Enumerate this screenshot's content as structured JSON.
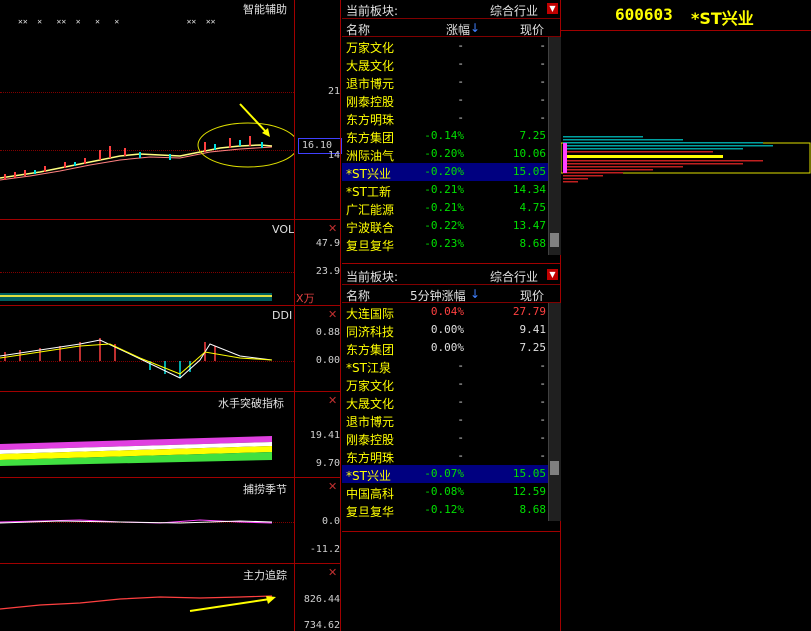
{
  "chart_area": {
    "main_panel": {
      "title": "智能辅助",
      "y_labels": [
        "21",
        "16.10",
        "14"
      ],
      "top_markers": "✕✕  ✕   ✕✕  ✕   ✕   ✕              ✕✕  ✕✕"
    },
    "vol_panel": {
      "title": "VOL",
      "y_labels": [
        "47.9",
        "23.9"
      ],
      "unit": "X万"
    },
    "ddi_panel": {
      "title": "DDI",
      "y_labels": [
        "0.88",
        "0.00"
      ]
    },
    "sailor_panel": {
      "title": "水手突破指标",
      "y_labels": [
        "19.41",
        "9.70"
      ]
    },
    "season_panel": {
      "title": "捕捞季节",
      "y_labels": [
        "0.0",
        "-11.2"
      ]
    },
    "main_force_panel": {
      "title": "主力追踪",
      "y_labels": [
        "826.44",
        "734.62"
      ]
    },
    "close_label": "✕"
  },
  "sector_list_1": {
    "label": "当前板块:",
    "dropdown": "综合行业",
    "headers": {
      "name": "名称",
      "change": "涨幅",
      "price": "现价"
    },
    "rows": [
      {
        "name": "万家文化",
        "change": "-",
        "price": "-"
      },
      {
        "name": "大晟文化",
        "change": "-",
        "price": "-"
      },
      {
        "name": "退市博元",
        "change": "-",
        "price": "-"
      },
      {
        "name": "刚泰控股",
        "change": "-",
        "price": "-"
      },
      {
        "name": "东方明珠",
        "change": "-",
        "price": "-"
      },
      {
        "name": "东方集团",
        "change": "-0.14%",
        "price": "7.25"
      },
      {
        "name": "洲际油气",
        "change": "-0.20%",
        "price": "10.06"
      },
      {
        "name": "*ST兴业",
        "change": "-0.20%",
        "price": "15.05"
      },
      {
        "name": "*ST工新",
        "change": "-0.21%",
        "price": "14.34"
      },
      {
        "name": "广汇能源",
        "change": "-0.21%",
        "price": "4.75"
      },
      {
        "name": "宁波联合",
        "change": "-0.22%",
        "price": "13.47"
      },
      {
        "name": "复旦复华",
        "change": "-0.23%",
        "price": "8.68"
      }
    ]
  },
  "sector_list_2": {
    "label": "当前板块:",
    "dropdown": "综合行业",
    "headers": {
      "name": "名称",
      "change": "5分钟涨幅",
      "price": "现价"
    },
    "rows": [
      {
        "name": "大连国际",
        "change": "0.04%",
        "price": "27.79"
      },
      {
        "name": "同济科技",
        "change": "0.00%",
        "price": "9.41"
      },
      {
        "name": "东方集团",
        "change": "0.00%",
        "price": "7.25"
      },
      {
        "name": "*ST江泉",
        "change": "-",
        "price": "-"
      },
      {
        "name": "万家文化",
        "change": "-",
        "price": "-"
      },
      {
        "name": "大晟文化",
        "change": "-",
        "price": "-"
      },
      {
        "name": "退市博元",
        "change": "-",
        "price": "-"
      },
      {
        "name": "刚泰控股",
        "change": "-",
        "price": "-"
      },
      {
        "name": "东方明珠",
        "change": "-",
        "price": "-"
      },
      {
        "name": "*ST兴业",
        "change": "-0.07%",
        "price": "15.05"
      },
      {
        "name": "中国高科",
        "change": "-0.08%",
        "price": "12.59"
      },
      {
        "name": "复旦复华",
        "change": "-0.12%",
        "price": "8.68"
      }
    ]
  },
  "stock_header": {
    "code": "600603",
    "name": "*ST兴业"
  },
  "colors": {
    "up": "#ff4040",
    "down": "#00e000",
    "name": "#ffff00",
    "grid": "#a00000",
    "selected": "#000080"
  }
}
